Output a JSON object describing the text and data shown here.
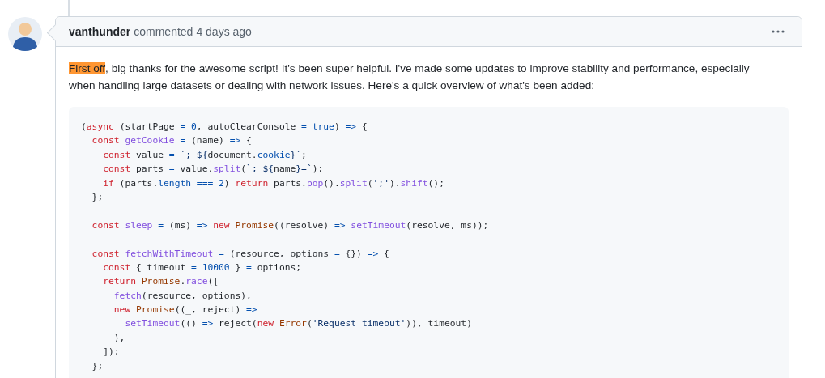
{
  "comment": {
    "author": "vanthunder",
    "action": "commented",
    "timestamp": "4 days ago",
    "body": {
      "highlighted": "First off",
      "text": ", big thanks for the awesome script! It's been super helpful. I've made some updates to improve stability and performance, especially when handling large datasets or dealing with network issues. Here's a quick overview of what's been added:"
    },
    "code": [
      {
        "kind": "code",
        "tokens": [
          {
            "kind": "plain",
            "text": "("
          },
          {
            "kind": "keyword",
            "text": "async"
          },
          {
            "kind": "plain",
            "text": " (startPage "
          },
          {
            "kind": "constant",
            "text": "= 0"
          },
          {
            "kind": "plain",
            "text": ", autoClearConsole "
          },
          {
            "kind": "constant",
            "text": "= true"
          },
          {
            "kind": "plain",
            "text": ") "
          },
          {
            "kind": "constant",
            "text": "=>"
          },
          {
            "kind": "plain",
            "text": " {"
          }
        ]
      },
      {
        "kind": "code",
        "tokens": [
          {
            "kind": "keyword",
            "text": "  const"
          },
          {
            "kind": "function",
            "text": " getCookie"
          },
          {
            "kind": "constant",
            "text": " ="
          },
          {
            "kind": "plain",
            "text": " (name) "
          },
          {
            "kind": "constant",
            "text": "=>"
          },
          {
            "kind": "plain",
            "text": " {"
          }
        ]
      },
      {
        "kind": "code",
        "tokens": [
          {
            "kind": "keyword",
            "text": "    const"
          },
          {
            "kind": "plain",
            "text": " value "
          },
          {
            "kind": "constant",
            "text": "="
          },
          {
            "kind": "string",
            "text": " `; ${"
          },
          {
            "kind": "plain",
            "text": "document."
          },
          {
            "kind": "constant",
            "text": "cookie"
          },
          {
            "kind": "string",
            "text": "}`"
          },
          {
            "kind": "plain",
            "text": ";"
          }
        ]
      },
      {
        "kind": "code",
        "tokens": [
          {
            "kind": "keyword",
            "text": "    const"
          },
          {
            "kind": "plain",
            "text": " parts "
          },
          {
            "kind": "constant",
            "text": "="
          },
          {
            "kind": "plain",
            "text": " value."
          },
          {
            "kind": "function",
            "text": "split"
          },
          {
            "kind": "plain",
            "text": "("
          },
          {
            "kind": "string",
            "text": "`; ${"
          },
          {
            "kind": "plain",
            "text": "name"
          },
          {
            "kind": "string",
            "text": "}=`"
          },
          {
            "kind": "plain",
            "text": ");"
          }
        ]
      },
      {
        "kind": "code",
        "tokens": [
          {
            "kind": "keyword",
            "text": "    if"
          },
          {
            "kind": "plain",
            "text": " (parts."
          },
          {
            "kind": "constant",
            "text": "length === 2"
          },
          {
            "kind": "plain",
            "text": ") "
          },
          {
            "kind": "keyword",
            "text": "return"
          },
          {
            "kind": "plain",
            "text": " parts."
          },
          {
            "kind": "function",
            "text": "pop"
          },
          {
            "kind": "plain",
            "text": "()."
          },
          {
            "kind": "function",
            "text": "split"
          },
          {
            "kind": "plain",
            "text": "("
          },
          {
            "kind": "string",
            "text": "';'"
          },
          {
            "kind": "plain",
            "text": ")."
          },
          {
            "kind": "function",
            "text": "shift"
          },
          {
            "kind": "plain",
            "text": "();"
          }
        ]
      },
      {
        "kind": "code",
        "tokens": [
          {
            "kind": "plain",
            "text": "  };"
          }
        ]
      },
      {
        "kind": "blank"
      },
      {
        "kind": "code",
        "tokens": [
          {
            "kind": "keyword",
            "text": "  const"
          },
          {
            "kind": "function",
            "text": " sleep"
          },
          {
            "kind": "constant",
            "text": " ="
          },
          {
            "kind": "plain",
            "text": " (ms) "
          },
          {
            "kind": "constant",
            "text": "=>"
          },
          {
            "kind": "keyword",
            "text": " new"
          },
          {
            "kind": "entity",
            "text": " Promise"
          },
          {
            "kind": "plain",
            "text": "((resolve) "
          },
          {
            "kind": "constant",
            "text": "=>"
          },
          {
            "kind": "function",
            "text": " setTimeout"
          },
          {
            "kind": "plain",
            "text": "(resolve, ms));"
          }
        ]
      },
      {
        "kind": "blank"
      },
      {
        "kind": "code",
        "tokens": [
          {
            "kind": "keyword",
            "text": "  const"
          },
          {
            "kind": "function",
            "text": " fetchWithTimeout"
          },
          {
            "kind": "constant",
            "text": " ="
          },
          {
            "kind": "plain",
            "text": " (resource, options "
          },
          {
            "kind": "constant",
            "text": "="
          },
          {
            "kind": "plain",
            "text": " {}) "
          },
          {
            "kind": "constant",
            "text": "=>"
          },
          {
            "kind": "plain",
            "text": " {"
          }
        ]
      },
      {
        "kind": "code",
        "tokens": [
          {
            "kind": "keyword",
            "text": "    const"
          },
          {
            "kind": "plain",
            "text": " { timeout "
          },
          {
            "kind": "constant",
            "text": "= 10000"
          },
          {
            "kind": "plain",
            "text": " } "
          },
          {
            "kind": "constant",
            "text": "="
          },
          {
            "kind": "plain",
            "text": " options;"
          }
        ]
      },
      {
        "kind": "code",
        "tokens": [
          {
            "kind": "keyword",
            "text": "    return"
          },
          {
            "kind": "entity",
            "text": " Promise"
          },
          {
            "kind": "plain",
            "text": "."
          },
          {
            "kind": "function",
            "text": "race"
          },
          {
            "kind": "plain",
            "text": "(["
          }
        ]
      },
      {
        "kind": "code",
        "tokens": [
          {
            "kind": "function",
            "text": "      fetch"
          },
          {
            "kind": "plain",
            "text": "(resource, options),"
          }
        ]
      },
      {
        "kind": "code",
        "tokens": [
          {
            "kind": "keyword",
            "text": "      new"
          },
          {
            "kind": "entity",
            "text": " Promise"
          },
          {
            "kind": "plain",
            "text": "((_, reject) "
          },
          {
            "kind": "constant",
            "text": "=>"
          }
        ]
      },
      {
        "kind": "code",
        "tokens": [
          {
            "kind": "function",
            "text": "        setTimeout"
          },
          {
            "kind": "plain",
            "text": "(() "
          },
          {
            "kind": "constant",
            "text": "=>"
          },
          {
            "kind": "plain",
            "text": " reject("
          },
          {
            "kind": "keyword",
            "text": "new"
          },
          {
            "kind": "entity",
            "text": " Error"
          },
          {
            "kind": "plain",
            "text": "("
          },
          {
            "kind": "string",
            "text": "'Request timeout'"
          },
          {
            "kind": "plain",
            "text": ")), timeout)"
          }
        ]
      },
      {
        "kind": "code",
        "tokens": [
          {
            "kind": "plain",
            "text": "      ),"
          }
        ]
      },
      {
        "kind": "code",
        "tokens": [
          {
            "kind": "plain",
            "text": "    ]);"
          }
        ]
      },
      {
        "kind": "code",
        "tokens": [
          {
            "kind": "plain",
            "text": "  };"
          }
        ]
      }
    ]
  }
}
